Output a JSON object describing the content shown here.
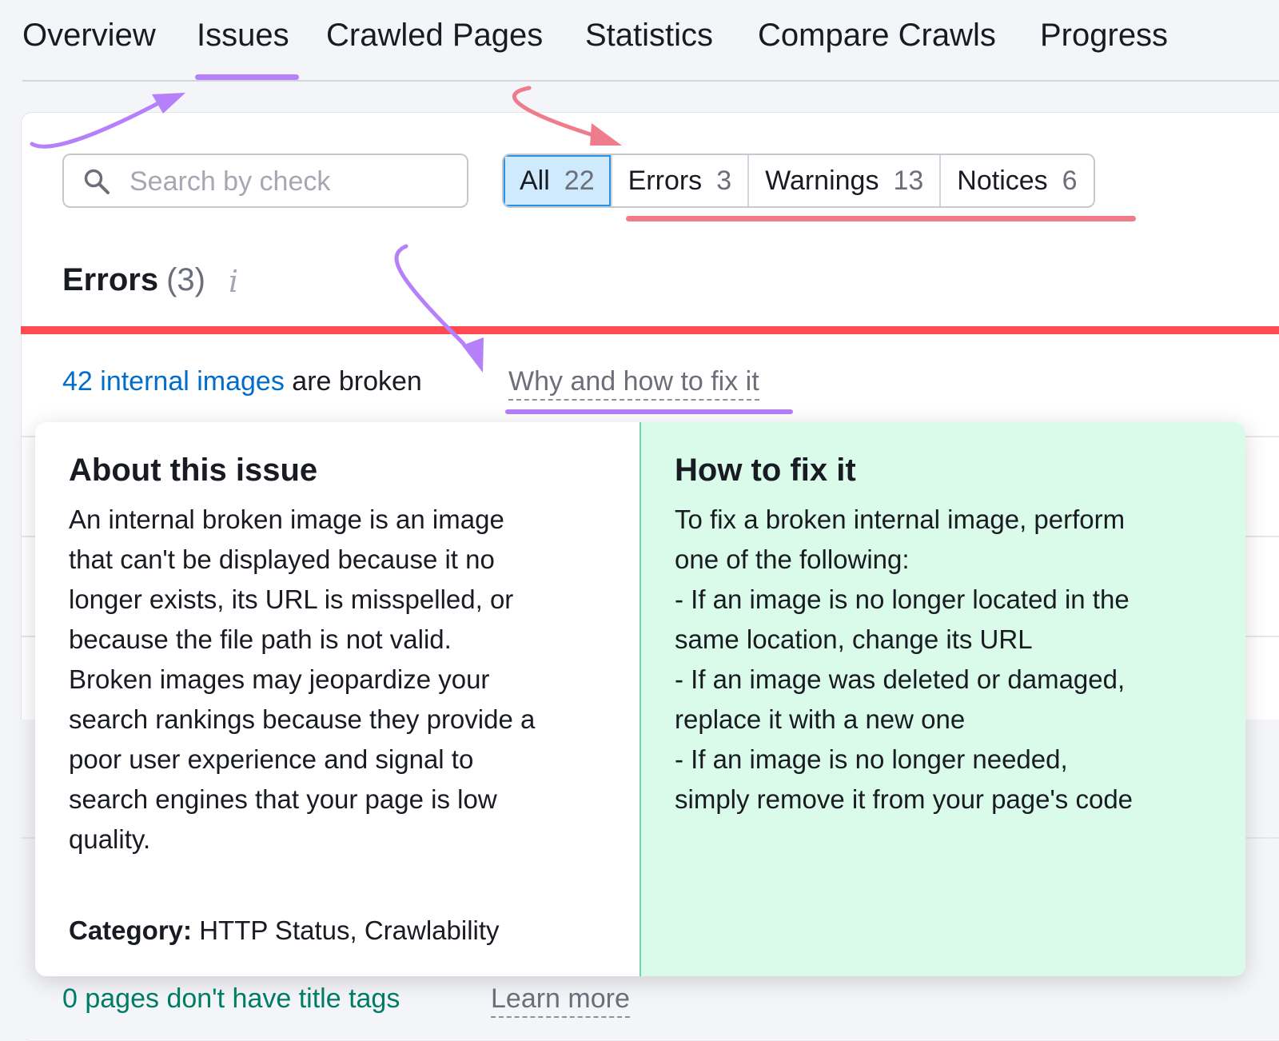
{
  "tabs": [
    {
      "label": "Overview"
    },
    {
      "label": "Issues",
      "active": true
    },
    {
      "label": "Crawled Pages"
    },
    {
      "label": "Statistics"
    },
    {
      "label": "Compare Crawls"
    },
    {
      "label": "Progress"
    }
  ],
  "search": {
    "placeholder": "Search by check",
    "value": ""
  },
  "filters": [
    {
      "label": "All",
      "count": "22",
      "active": true
    },
    {
      "label": "Errors",
      "count": "3"
    },
    {
      "label": "Warnings",
      "count": "13"
    },
    {
      "label": "Notices",
      "count": "6"
    }
  ],
  "section": {
    "title": "Errors",
    "count": "(3)",
    "info_icon": "info-icon"
  },
  "issue": {
    "link_text": "42 internal images",
    "rest_text": "are broken",
    "why_link": "Why and how to fix it"
  },
  "popover": {
    "about_title": "About this issue",
    "about_body": "An internal broken image is an image\nthat can't be displayed because it no\nlonger exists, its URL is misspelled, or\nbecause the file path is not valid.\nBroken images may jeopardize your\nsearch rankings because they provide a\npoor user experience and signal to\nsearch engines that your page is low\nquality.",
    "category_label": "Category:",
    "category_value": "HTTP Status, Crawlability",
    "fix_title": "How to fix it",
    "fix_body": "To fix a broken internal image, perform\none of the following:\n- If an image is no longer located in the\nsame location, change its URL\n- If an image was deleted or damaged,\nreplace it with a new one\n- If an image is no longer needed,\nsimply remove it from your page's code"
  },
  "bottom_issue": {
    "link_text": "0 pages don't have title tags",
    "learn_more": "Learn more"
  },
  "colors": {
    "accent_purple": "#b580f9",
    "annotation_pink": "#ee7c8a",
    "error_red": "#ff4953",
    "link_blue": "#006dca",
    "link_green": "#007c65",
    "fix_panel_bg": "#dafbe9"
  }
}
